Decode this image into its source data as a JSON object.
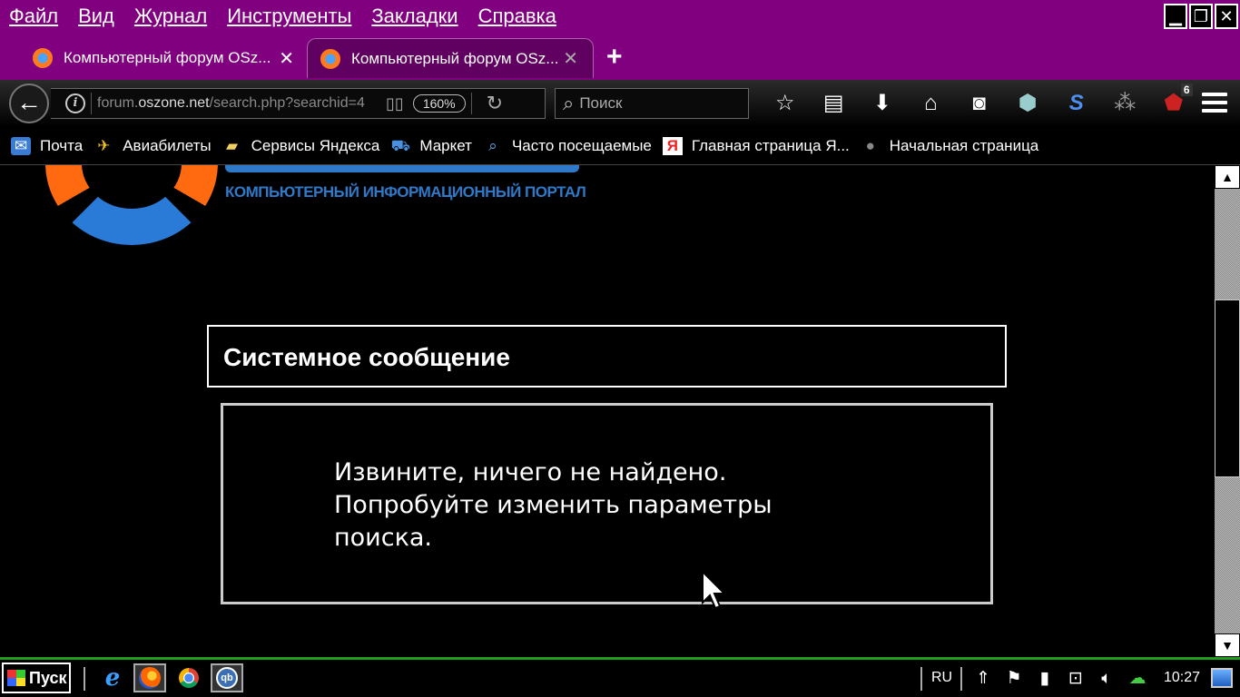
{
  "menu": {
    "items": [
      "Файл",
      "Вид",
      "Журнал",
      "Инструменты",
      "Закладки",
      "Справка"
    ]
  },
  "window_controls": {
    "minimize": "▁",
    "restore": "❐",
    "close": "✕"
  },
  "tabs": [
    {
      "title": "Компьютерный форум OSz...",
      "close": "✕",
      "active": false
    },
    {
      "title": "Компьютерный форум OSz...",
      "close": "✕",
      "active": true
    }
  ],
  "new_tab": "+",
  "navbar": {
    "url_prefix": "forum.",
    "url_host": "oszone.net",
    "url_suffix": "/search.php?searchid=4",
    "zoom": "160%",
    "search_placeholder": "Поиск",
    "addon_badge": "6"
  },
  "bookmarks": [
    {
      "label": "Почта",
      "icon": "mail-icon"
    },
    {
      "label": "Авиабилеты",
      "icon": "plane-icon"
    },
    {
      "label": "Сервисы Яндекса",
      "icon": "folder-icon"
    },
    {
      "label": "Маркет",
      "icon": "cart-icon"
    },
    {
      "label": "Часто посещаемые",
      "icon": "search-folder-icon"
    },
    {
      "label": "Главная страница Я...",
      "icon": "yandex-icon"
    },
    {
      "label": "Начальная страница",
      "icon": "globe-icon"
    }
  ],
  "page": {
    "logo_subtitle": "КОМПЬЮТЕРНЫЙ ИНФОРМАЦИОННЫЙ ПОРТАЛ",
    "message_title": "Системное сообщение",
    "message_text": "Извините, ничего не найдено. Попробуйте изменить параметры поиска."
  },
  "taskbar": {
    "start_label": "Пуск",
    "language": "RU",
    "clock": "10:27"
  },
  "colors": {
    "menubar": "#800080",
    "taskbar_border": "#1e9e1e",
    "logo_blue": "#2f79c9",
    "logo_orange": "#ff6a10"
  }
}
